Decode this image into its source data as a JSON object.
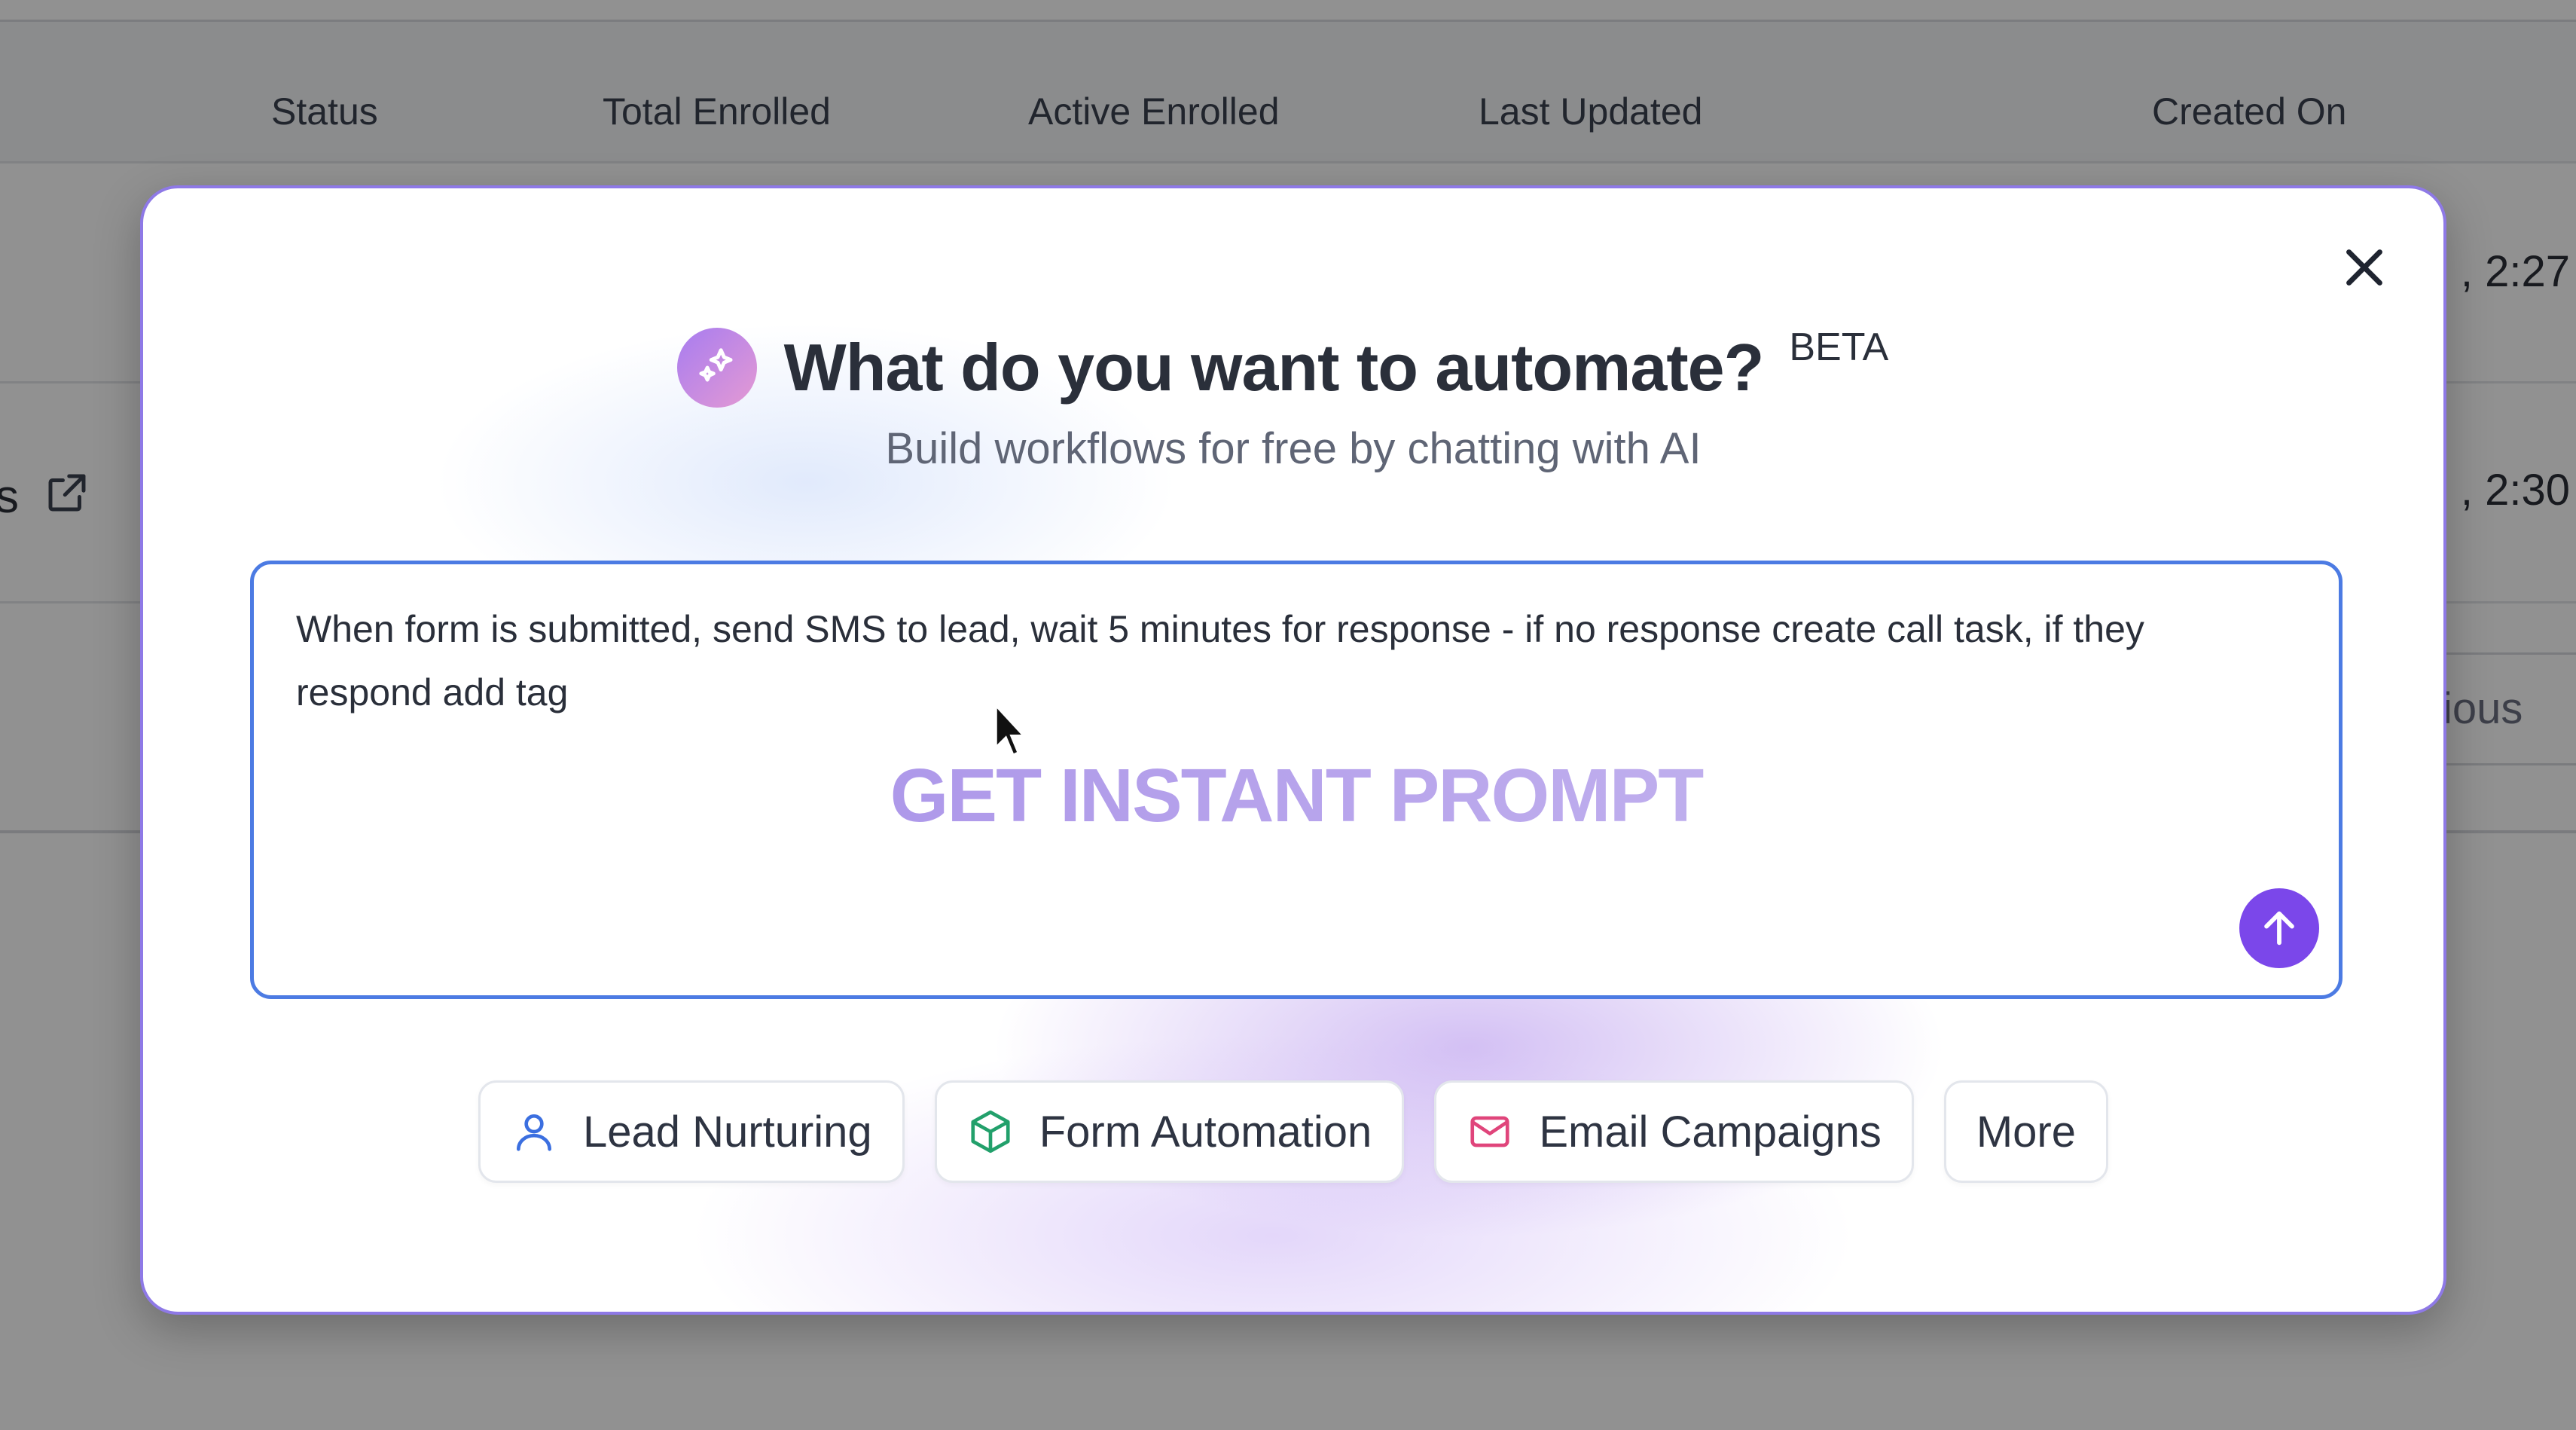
{
  "background": {
    "columns": [
      "Status",
      "Total Enrolled",
      "Active Enrolled",
      "Last Updated",
      "Created On"
    ],
    "row_times": [
      ", 2:27",
      ", 2:30"
    ],
    "row_fragment": "s",
    "previous_button_fragment": "ious"
  },
  "modal": {
    "title": "What do you want to automate?",
    "beta_label": "BETA",
    "subtitle": "Build workflows for free by chatting with AI",
    "prompt": {
      "value": "When form is submitted, send SMS to lead, wait 5 minutes for response - if no response create call task, if they respond add tag",
      "overlay_text": "GET INSTANT PROMPT"
    },
    "chips": [
      {
        "label": "Lead Nurturing",
        "icon": "user-icon",
        "color": "#3b6fe0"
      },
      {
        "label": "Form Automation",
        "icon": "cube-icon",
        "color": "#22a06b"
      },
      {
        "label": "Email Campaigns",
        "icon": "mail-icon",
        "color": "#e0457b"
      },
      {
        "label": "More"
      }
    ]
  },
  "colors": {
    "accent": "#7b47ea",
    "input_border": "#4c7be3",
    "modal_border": "#8e79e6"
  }
}
